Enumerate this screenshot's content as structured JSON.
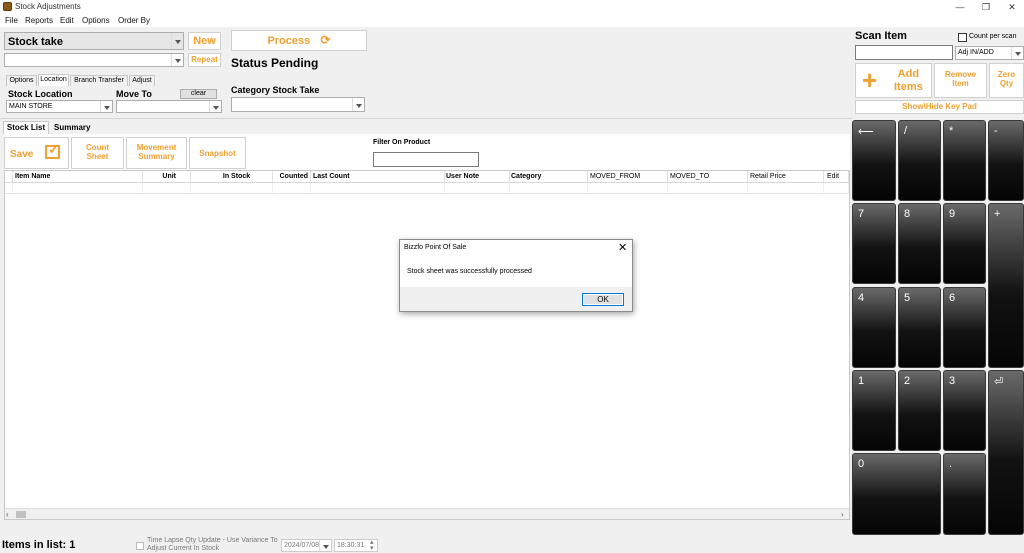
{
  "window": {
    "title": "Stock Adjustments",
    "controls": [
      "—",
      "❐",
      "✕"
    ]
  },
  "menu": [
    "File",
    "Reports",
    "Edit",
    "Options",
    "Order By"
  ],
  "header": {
    "mode_select": "Stock take",
    "new_button": "New",
    "repeat_button": "Repeat",
    "process_button": "Process",
    "status": "Status Pending"
  },
  "option_tabs": [
    "Options",
    "Location",
    "Branch Transfer",
    "Adjust"
  ],
  "location": {
    "stock_location_label": "Stock Location",
    "stock_location_value": "MAIN STORE",
    "move_to_label": "Move To",
    "move_to_value": "",
    "clear_button": "clear"
  },
  "category": {
    "label": "Category Stock Take",
    "value": ""
  },
  "list_tabs": [
    "Stock List",
    "Summary"
  ],
  "actions": {
    "save": "Save",
    "count_sheet": [
      "Count",
      "Sheet"
    ],
    "movement_summary": [
      "Movement",
      "Summary"
    ],
    "snapshot": "Snapshot"
  },
  "filter": {
    "label": "Filter On Product",
    "value": ""
  },
  "grid": {
    "columns": [
      "Item Name",
      "Unit",
      "In Stock",
      "Counted",
      "Last Count",
      "User Note",
      "Category",
      "MOVED_FROM",
      "MOVED_TO",
      "Retail Price",
      "Edit"
    ]
  },
  "scan": {
    "title": "Scan Item",
    "count_per_scan_label": "Count per scan",
    "input_value": "",
    "adjust_mode": "Adj IN/ADD",
    "add_items": [
      "Add",
      "Items"
    ],
    "remove_item": [
      "Remove",
      "Item"
    ],
    "zero_qty": [
      "Zero",
      "Qty"
    ],
    "show_hide_keypad": "Show\\Hide Key Pad"
  },
  "keypad": [
    "⟵",
    "/",
    "*",
    "-",
    "7",
    "8",
    "9",
    "+",
    "4",
    "5",
    "6",
    "1",
    "2",
    "3",
    "⏎",
    "0",
    "."
  ],
  "dialog": {
    "title": "Bizzfo Point Of Sale",
    "message": "Stock sheet was successfully processed",
    "ok": "OK"
  },
  "footer": {
    "items_in_list": "Items in list: 1",
    "time_lapse_label": [
      "Time Lapse Qty Update - Use Variance To",
      "Adjust Current In Stock"
    ],
    "date": "2024/07/08",
    "time": "18:30:31"
  }
}
